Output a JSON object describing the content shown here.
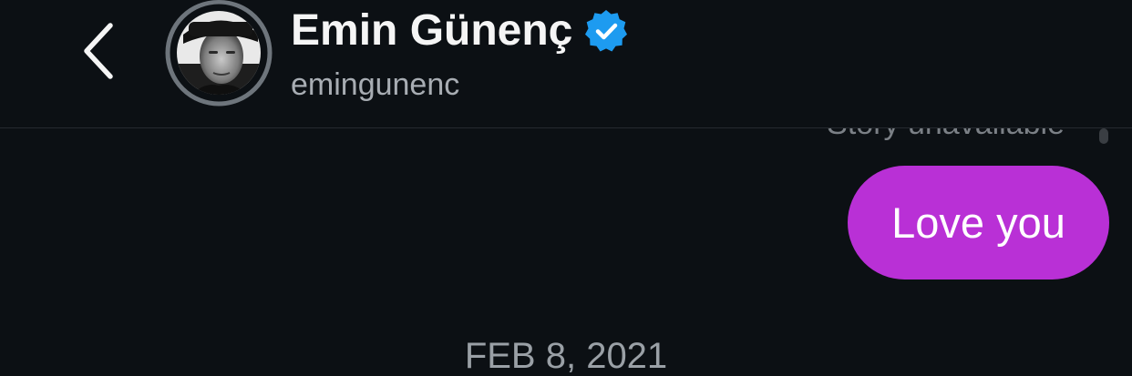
{
  "header": {
    "contact_name": "Emin Günenç",
    "username": "emingunenc",
    "verified": true,
    "icons": [
      "chevron-left-icon",
      "verified-badge-icon"
    ]
  },
  "thread": {
    "status_note": "Story unavailable",
    "messages": [
      {
        "text": "Love you",
        "sender": "me"
      }
    ],
    "date_separator": "FEB 8, 2021"
  },
  "colors": {
    "background": "#0c1014",
    "bubble": "#b930d6",
    "verified_blue": "#1d9bf0",
    "secondary_text": "#a8adb3"
  }
}
